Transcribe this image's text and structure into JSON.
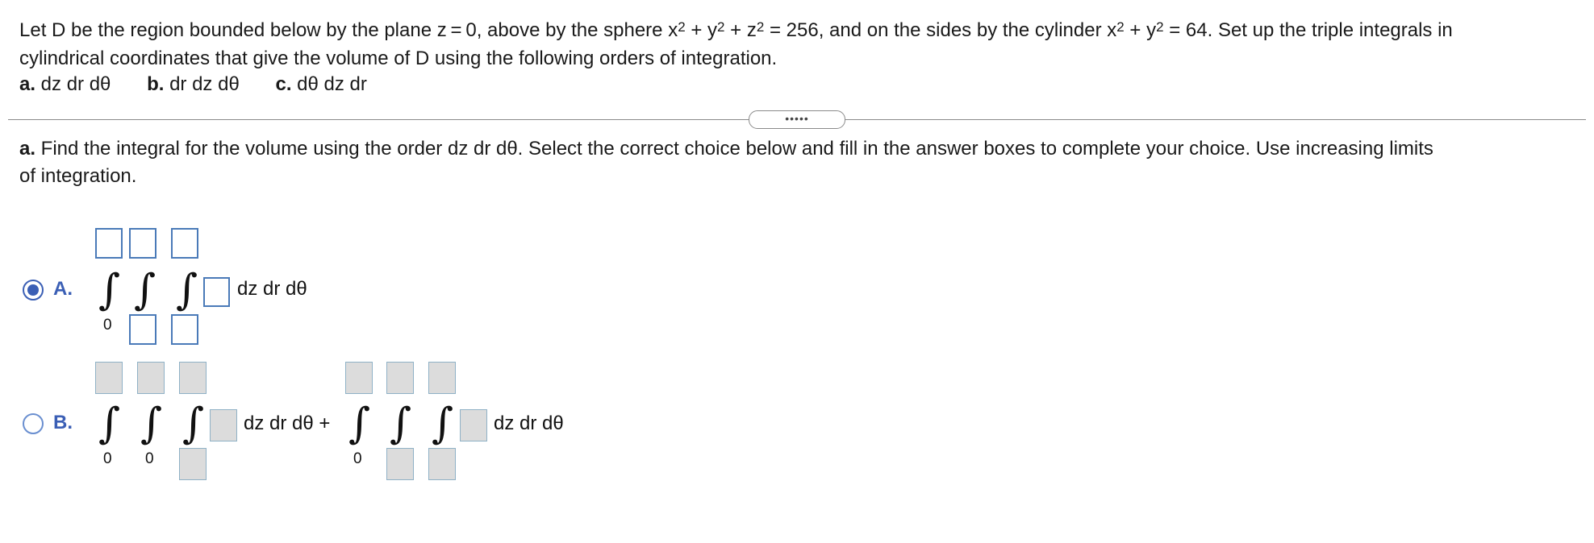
{
  "problem": {
    "line1_prefix": "Let D be the region bounded below by the plane z = 0, above by the sphere x",
    "sq": "2",
    "plus": " + y",
    "plus_z": " + z",
    "sphere_eq_suffix": " = 256, and on the sides by the cylinder x",
    "cyl_suffix": " = 64. Set up the triple integrals in",
    "line2": "cylindrical coordinates that give the volume of D using the following orders of integration.",
    "parts": [
      {
        "letter": "a.",
        "text": " dz dr dθ"
      },
      {
        "letter": "b.",
        "text": " dr dz dθ"
      },
      {
        "letter": "c.",
        "text": " dθ dz dr"
      }
    ]
  },
  "divider_button": "•••••",
  "question": {
    "letter": "a.",
    "line1": " Find the integral for the volume using the order dz dr dθ. Select the correct choice below and fill in the answer boxes to complete your choice. Use increasing limits",
    "line2": "of integration."
  },
  "options": [
    {
      "label": "A.",
      "selected": true,
      "lower_limit": "0",
      "differential": "dz dr dθ"
    },
    {
      "label": "B.",
      "selected": false,
      "lower_limits": [
        "0",
        "0",
        "0"
      ],
      "differential_1": "dz dr dθ +",
      "differential_2": "dz dr dθ"
    }
  ],
  "integral_sign": "∫",
  "colors": {
    "accent": "#3b5fb5",
    "active_box_border": "#4a7ab8",
    "disabled_box_bg": "#dcdcdc",
    "disabled_box_border": "#8fb1c6"
  }
}
